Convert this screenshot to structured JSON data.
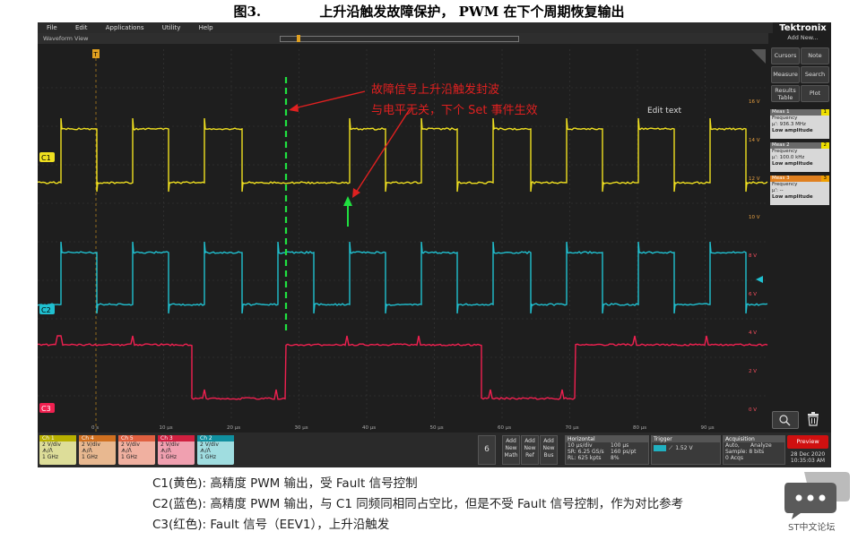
{
  "figure": {
    "number": "图3.",
    "title": "上升沿触发故障保护， PWM 在下个周期恢复输出"
  },
  "menu": [
    "File",
    "Edit",
    "Applications",
    "Utility",
    "Help"
  ],
  "brand": {
    "logo": "Tektronix",
    "add_new": "Add New..."
  },
  "waveform_view": {
    "label": "Waveform View"
  },
  "side_buttons": {
    "cursors": "Cursors",
    "note": "Note",
    "measure": "Measure",
    "search": "Search",
    "results_table": "Results Table",
    "plot": "Plot"
  },
  "measurements": [
    {
      "name": "Meas 1",
      "badge": "1",
      "type": "Frequency",
      "value": "μ': 936.3 MHz",
      "note": "Low amplitude",
      "color": "#f0e000"
    },
    {
      "name": "Meas 2",
      "badge": "2",
      "type": "Frequency",
      "value": "μ': 100.0 kHz",
      "note": "Low amplitude",
      "color": "#20c0d0"
    },
    {
      "name": "Meas 3",
      "badge": "3",
      "type": "Frequency",
      "value": "μ': --",
      "note": "Low amplitude",
      "color": "#f08000"
    }
  ],
  "channel_markers": {
    "c1": "C1",
    "c2": "C2",
    "c3": "C3"
  },
  "x_ticks": [
    "0 s",
    "10 μs",
    "20 μs",
    "30 μs",
    "40 μs",
    "50 μs",
    "60 μs",
    "70 μs",
    "80 μs",
    "90 μs"
  ],
  "y_right_ticks": [
    "16 V",
    "14 V",
    "12 V",
    "10 V",
    "8 V",
    "6 V",
    "4 V",
    "2 V",
    "0 V"
  ],
  "annotations": {
    "line1": "故障信号上升沿触发封波",
    "line2": "与电平无关，下个 Set 事件生效",
    "edit_text": "Edit text"
  },
  "channels": [
    {
      "name": "Ch 1",
      "scale": "2 V/div",
      "coupling": "ᗑ/ᐱ",
      "bw": "1 GHz",
      "color": "#c8c200"
    },
    {
      "name": "Ch 4",
      "scale": "2 V/div",
      "coupling": "ᗑ/ᐱ",
      "bw": "1 GHz",
      "color": "#e08020"
    },
    {
      "name": "Ch 5",
      "scale": "2 V/div",
      "coupling": "ᗑ/ᐱ",
      "bw": "1 GHz",
      "color": "#f07050"
    },
    {
      "name": "Ch 3",
      "scale": "2 V/div",
      "coupling": "ᗑ/ᐱ",
      "bw": "1 GHz",
      "color": "#e03050"
    },
    {
      "name": "Ch 2",
      "scale": "2 V/div",
      "coupling": "ᗑ/ᐱ",
      "bw": "1 GHz",
      "color": "#20b0c0"
    }
  ],
  "bottom_controls": {
    "count": "6",
    "add_math": "Add New Math",
    "add_ref": "Add New Ref",
    "add_bus": "Add New Bus",
    "horizontal": {
      "title": "Horizontal",
      "l1a": "10 μs/div",
      "l1b": "100 μs",
      "l2a": "SR: 6.25 GS/s",
      "l2b": "160 ps/pt",
      "l3a": "RL: 625 kpts",
      "l3b": "8%"
    },
    "trigger": {
      "title": "Trigger",
      "value": "1.52 V"
    },
    "acquisition": {
      "title": "Acquisition",
      "l1a": "Auto,",
      "l1b": "Analyze",
      "l2a": "Sample: 8 bits",
      "l3a": "0 Acqs"
    },
    "preview": "Preview",
    "date": "28 Dec 2020",
    "time": "10:35:03 AM"
  },
  "captions": [
    "C1(黄色):  高精度 PWM 输出，受 Fault 信号控制",
    "C2(蓝色):  高精度 PWM 输出，与 C1 同频同相同占空比，但是不受 Fault 信号控制，作为对比参考",
    "C3(红色):  Fault 信号（EEV1），上升沿触发"
  ],
  "watermark": "ST中文论坛",
  "colors": {
    "ch1": "#f0e020",
    "ch2": "#20c0d0",
    "ch3": "#f02050",
    "annot": "#e02020",
    "green": "#20e040"
  }
}
